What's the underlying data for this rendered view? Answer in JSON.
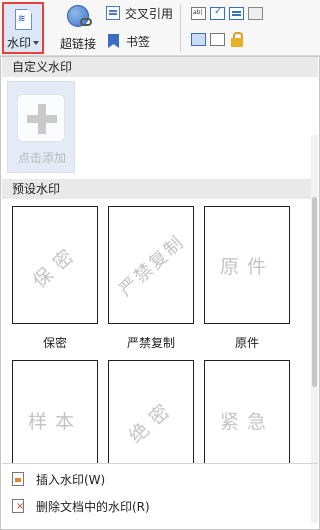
{
  "ribbon": {
    "watermark_label": "水印",
    "watermark_icon_glyph": "≋",
    "hyperlink_label": "超链接",
    "crossref_label": "交叉引用",
    "bookmark_label": "书签"
  },
  "panel": {
    "custom_section_title": "自定义水印",
    "add_label": "点击添加",
    "preset_section_title": "预设水印",
    "presets": [
      {
        "label": "保密",
        "mark": "保密"
      },
      {
        "label": "严禁复制",
        "mark": "严禁复制"
      },
      {
        "label": "原件",
        "mark": "原件"
      },
      {
        "label": "",
        "mark": "样本"
      },
      {
        "label": "",
        "mark": "绝密"
      },
      {
        "label": "",
        "mark": "紧急"
      }
    ],
    "menu": {
      "insert_label": "插入水印(W)",
      "delete_label": "删除文档中的水印(R)"
    }
  }
}
